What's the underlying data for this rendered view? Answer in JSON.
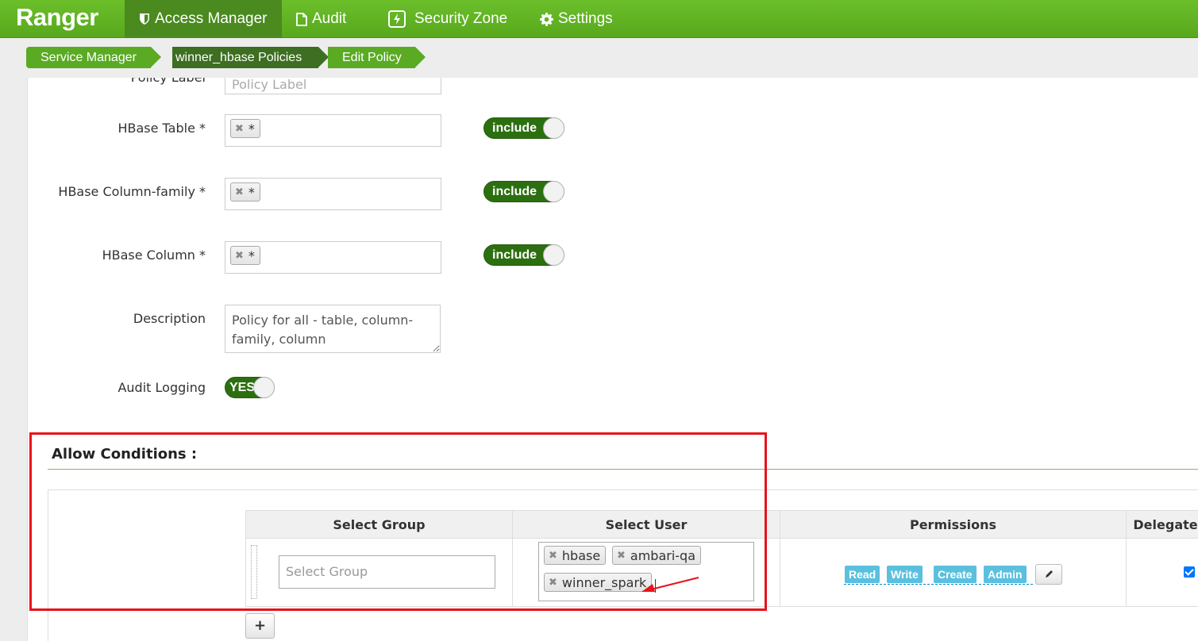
{
  "navbar": {
    "brand": "Ranger",
    "items": [
      {
        "label": "Access Manager",
        "icon": "shield-icon",
        "active": true
      },
      {
        "label": "Audit",
        "icon": "file-icon"
      },
      {
        "label": "Security Zone",
        "icon": "bolt-icon"
      },
      {
        "label": "Settings",
        "icon": "gear-icon"
      }
    ]
  },
  "breadcrumb": [
    "Service Manager",
    "winner_hbase Policies",
    "Edit Policy"
  ],
  "form": {
    "policy_label": {
      "label": "Policy Label",
      "placeholder": "Policy Label"
    },
    "hbase_table": {
      "label": "HBase Table *",
      "tag": "*",
      "toggle": "include"
    },
    "column_family": {
      "label": "HBase Column-family *",
      "tag": "*",
      "toggle": "include"
    },
    "column": {
      "label": "HBase Column *",
      "tag": "*",
      "toggle": "include"
    },
    "description": {
      "label": "Description",
      "value": "Policy for all - table, column-family, column"
    },
    "audit_logging": {
      "label": "Audit Logging",
      "toggle": "YES"
    }
  },
  "allow_conditions": {
    "title": "Allow Conditions :",
    "headers": [
      "Select Group",
      "Select User",
      "Permissions",
      "Delegate"
    ],
    "row": {
      "group_placeholder": "Select Group",
      "users": [
        "hbase",
        "ambari-qa",
        "winner_spark"
      ],
      "permissions": [
        "Read",
        "Write",
        "Create",
        "Admin"
      ],
      "delegate_checked": true
    },
    "add_label": "+"
  },
  "colors": {
    "brand_green": "#5aaa24",
    "toggle_green": "#2c6f10",
    "perm_blue": "#5bc0de",
    "highlight_red": "#e8121a"
  }
}
